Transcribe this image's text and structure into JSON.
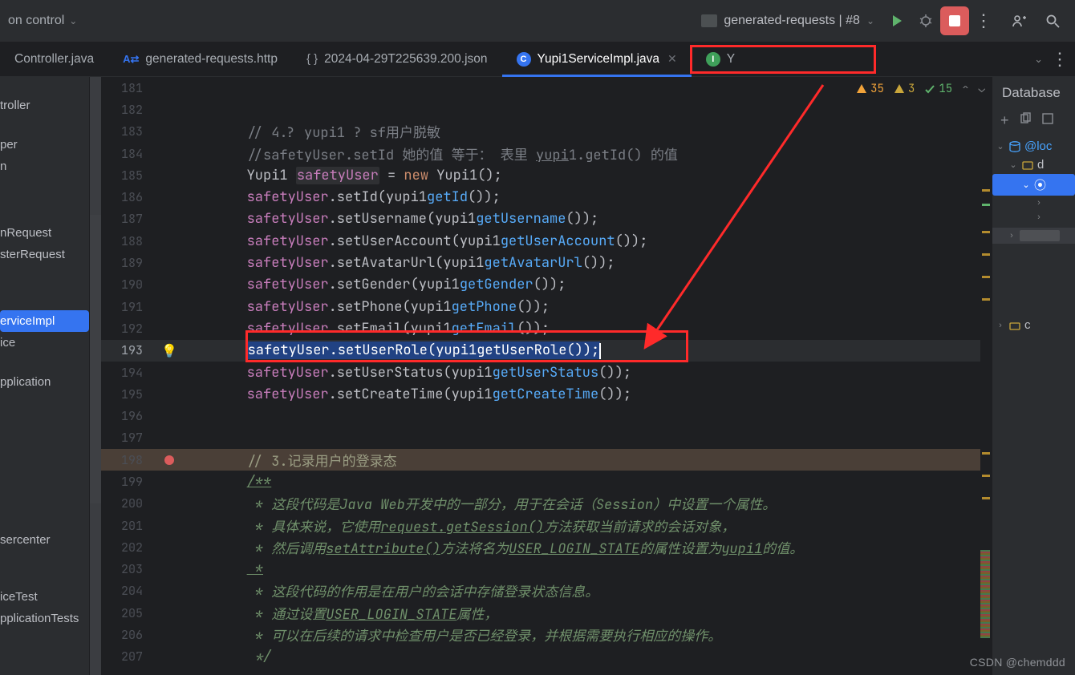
{
  "topbar": {
    "left_text": "on control",
    "run_config_label": "generated-requests | #8"
  },
  "tabs": {
    "tab0_label": "Controller.java",
    "tab1_label": "generated-requests.http",
    "tab2_label": "2024-04-29T225639.200.json",
    "tab3_label": "Yupi1ServiceImpl.java",
    "tab4_label": "Y"
  },
  "inspections": {
    "errors": "35",
    "warnings": "3",
    "typos": "15"
  },
  "sidebar": {
    "items": [
      "troller",
      "per",
      "n",
      "nRequest",
      "sterRequest",
      "erviceImpl",
      "ice",
      "pplication",
      "sercenter",
      "iceTest",
      "pplicationTests"
    ]
  },
  "code_lines": {
    "l181": {
      "num": "181",
      "text": ""
    },
    "l182": {
      "num": "182",
      "text": ""
    },
    "l183": {
      "num": "183",
      "com": "// 4.? yupi1 ? sf用户脱敏"
    },
    "l184": {
      "num": "184",
      "com": "//safetyUser.setId 她的值 等于： 表里 ",
      "u1": "yupi",
      "u2": "1.getId() 的值"
    },
    "l185": {
      "num": "185",
      "type": "Yupi1 ",
      "var": "safetyUser",
      " a": " = ",
      "kw": "new",
      " b": " Yupi1();"
    },
    "l186": {
      "num": "186",
      "v": "safetyUser",
      "f": ".setId(",
      "p": "yupi1",
      ".": ".",
      "m": "getId",
      "t": "());"
    },
    "l187": {
      "num": "187",
      "v": "safetyUser",
      "f": ".setUsername(",
      "p": "yupi1",
      ".": ".",
      "m": "getUsername",
      "t": "());"
    },
    "l188": {
      "num": "188",
      "v": "safetyUser",
      "f": ".setUserAccount(",
      "p": "yupi1",
      ".": ".",
      "m": "getUserAccount",
      "t": "());"
    },
    "l189": {
      "num": "189",
      "v": "safetyUser",
      "f": ".setAvatarUrl(",
      "p": "yupi1",
      ".": ".",
      "m": "getAvatarUrl",
      "t": "());"
    },
    "l190": {
      "num": "190",
      "v": "safetyUser",
      "f": ".setGender(",
      "p": "yupi1",
      ".": ".",
      "m": "getGender",
      "t": "());"
    },
    "l191": {
      "num": "191",
      "v": "safetyUser",
      "f": ".setPhone(",
      "p": "yupi1",
      ".": ".",
      "m": "getPhone",
      "t": "());"
    },
    "l192": {
      "num": "192",
      "v": "safetyUser",
      "f": ".setEmail(",
      "p": "yupi1",
      ".": ".",
      "m": "getEmail",
      "t": "());"
    },
    "l193": {
      "num": "193",
      "v": "safetyUser",
      "f": ".setUserRole(",
      "p": "yupi1",
      ".": ".",
      "m": "getUserRole",
      "t": "());"
    },
    "l194": {
      "num": "194",
      "v": "safetyUser",
      "f": ".setUserStatus(",
      "p": "yupi1",
      ".": ".",
      "m": "getUserStatus",
      "t": "());"
    },
    "l195": {
      "num": "195",
      "v": "safetyUser",
      "f": ".setCreateTime(",
      "p": "yupi1",
      ".": ".",
      "m": "getCreateTime",
      "t": "());"
    },
    "l196": {
      "num": "196",
      "text": ""
    },
    "l197": {
      "num": "197",
      "text": ""
    },
    "l198": {
      "num": "198",
      "com": "// 3.记录用户的登录态"
    },
    "l199": {
      "num": "199",
      "doc": "/**"
    },
    "l200": {
      "num": "200",
      "doc": " * 这段代码是Java Web开发中的一部分，用于在会话（Session）中设置一个属性。"
    },
    "l201": {
      "num": "201",
      "doc_a": " * 具体来说，它使用",
      "doc_u": "request.getSession()",
      "doc_b": "方法获取当前请求的会话对象，"
    },
    "l202": {
      "num": "202",
      "doc_a": " * 然后调用",
      "doc_u": "setAttribute()",
      "doc_b": "方法将名为",
      "doc_u2": "USER_LOGIN_STATE",
      "doc_c": "的属性设置为",
      "doc_u3": "yupi1",
      "doc_d": "的值。"
    },
    "l203": {
      "num": "203",
      "doc": " *"
    },
    "l204": {
      "num": "204",
      "doc": " * 这段代码的作用是在用户的会话中存储登录状态信息。"
    },
    "l205": {
      "num": "205",
      "doc_a": " * 通过设置",
      "doc_u": "USER_LOGIN_STATE",
      "doc_b": "属性，"
    },
    "l206": {
      "num": "206",
      "doc": " * 可以在后续的请求中检查用户是否已经登录，并根据需要执行相应的操作。"
    },
    "l207": {
      "num": "207",
      "doc": " */"
    }
  },
  "db": {
    "title": "Database",
    "root": "@loc",
    "tree": {
      "l1": "d",
      "l3": "c"
    }
  },
  "watermark": "CSDN @chemddd"
}
